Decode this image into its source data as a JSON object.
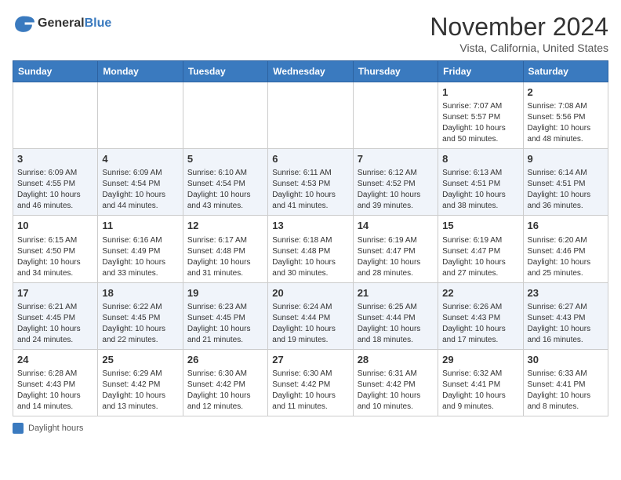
{
  "header": {
    "logo_line1": "General",
    "logo_line2": "Blue",
    "month": "November 2024",
    "location": "Vista, California, United States"
  },
  "weekdays": [
    "Sunday",
    "Monday",
    "Tuesday",
    "Wednesday",
    "Thursday",
    "Friday",
    "Saturday"
  ],
  "weeks": [
    [
      {
        "day": "",
        "info": ""
      },
      {
        "day": "",
        "info": ""
      },
      {
        "day": "",
        "info": ""
      },
      {
        "day": "",
        "info": ""
      },
      {
        "day": "",
        "info": ""
      },
      {
        "day": "1",
        "info": "Sunrise: 7:07 AM\nSunset: 5:57 PM\nDaylight: 10 hours and 50 minutes."
      },
      {
        "day": "2",
        "info": "Sunrise: 7:08 AM\nSunset: 5:56 PM\nDaylight: 10 hours and 48 minutes."
      }
    ],
    [
      {
        "day": "3",
        "info": "Sunrise: 6:09 AM\nSunset: 4:55 PM\nDaylight: 10 hours and 46 minutes."
      },
      {
        "day": "4",
        "info": "Sunrise: 6:09 AM\nSunset: 4:54 PM\nDaylight: 10 hours and 44 minutes."
      },
      {
        "day": "5",
        "info": "Sunrise: 6:10 AM\nSunset: 4:54 PM\nDaylight: 10 hours and 43 minutes."
      },
      {
        "day": "6",
        "info": "Sunrise: 6:11 AM\nSunset: 4:53 PM\nDaylight: 10 hours and 41 minutes."
      },
      {
        "day": "7",
        "info": "Sunrise: 6:12 AM\nSunset: 4:52 PM\nDaylight: 10 hours and 39 minutes."
      },
      {
        "day": "8",
        "info": "Sunrise: 6:13 AM\nSunset: 4:51 PM\nDaylight: 10 hours and 38 minutes."
      },
      {
        "day": "9",
        "info": "Sunrise: 6:14 AM\nSunset: 4:51 PM\nDaylight: 10 hours and 36 minutes."
      }
    ],
    [
      {
        "day": "10",
        "info": "Sunrise: 6:15 AM\nSunset: 4:50 PM\nDaylight: 10 hours and 34 minutes."
      },
      {
        "day": "11",
        "info": "Sunrise: 6:16 AM\nSunset: 4:49 PM\nDaylight: 10 hours and 33 minutes."
      },
      {
        "day": "12",
        "info": "Sunrise: 6:17 AM\nSunset: 4:48 PM\nDaylight: 10 hours and 31 minutes."
      },
      {
        "day": "13",
        "info": "Sunrise: 6:18 AM\nSunset: 4:48 PM\nDaylight: 10 hours and 30 minutes."
      },
      {
        "day": "14",
        "info": "Sunrise: 6:19 AM\nSunset: 4:47 PM\nDaylight: 10 hours and 28 minutes."
      },
      {
        "day": "15",
        "info": "Sunrise: 6:19 AM\nSunset: 4:47 PM\nDaylight: 10 hours and 27 minutes."
      },
      {
        "day": "16",
        "info": "Sunrise: 6:20 AM\nSunset: 4:46 PM\nDaylight: 10 hours and 25 minutes."
      }
    ],
    [
      {
        "day": "17",
        "info": "Sunrise: 6:21 AM\nSunset: 4:45 PM\nDaylight: 10 hours and 24 minutes."
      },
      {
        "day": "18",
        "info": "Sunrise: 6:22 AM\nSunset: 4:45 PM\nDaylight: 10 hours and 22 minutes."
      },
      {
        "day": "19",
        "info": "Sunrise: 6:23 AM\nSunset: 4:45 PM\nDaylight: 10 hours and 21 minutes."
      },
      {
        "day": "20",
        "info": "Sunrise: 6:24 AM\nSunset: 4:44 PM\nDaylight: 10 hours and 19 minutes."
      },
      {
        "day": "21",
        "info": "Sunrise: 6:25 AM\nSunset: 4:44 PM\nDaylight: 10 hours and 18 minutes."
      },
      {
        "day": "22",
        "info": "Sunrise: 6:26 AM\nSunset: 4:43 PM\nDaylight: 10 hours and 17 minutes."
      },
      {
        "day": "23",
        "info": "Sunrise: 6:27 AM\nSunset: 4:43 PM\nDaylight: 10 hours and 16 minutes."
      }
    ],
    [
      {
        "day": "24",
        "info": "Sunrise: 6:28 AM\nSunset: 4:43 PM\nDaylight: 10 hours and 14 minutes."
      },
      {
        "day": "25",
        "info": "Sunrise: 6:29 AM\nSunset: 4:42 PM\nDaylight: 10 hours and 13 minutes."
      },
      {
        "day": "26",
        "info": "Sunrise: 6:30 AM\nSunset: 4:42 PM\nDaylight: 10 hours and 12 minutes."
      },
      {
        "day": "27",
        "info": "Sunrise: 6:30 AM\nSunset: 4:42 PM\nDaylight: 10 hours and 11 minutes."
      },
      {
        "day": "28",
        "info": "Sunrise: 6:31 AM\nSunset: 4:42 PM\nDaylight: 10 hours and 10 minutes."
      },
      {
        "day": "29",
        "info": "Sunrise: 6:32 AM\nSunset: 4:41 PM\nDaylight: 10 hours and 9 minutes."
      },
      {
        "day": "30",
        "info": "Sunrise: 6:33 AM\nSunset: 4:41 PM\nDaylight: 10 hours and 8 minutes."
      }
    ]
  ],
  "legend": {
    "daylight_label": "Daylight hours"
  }
}
